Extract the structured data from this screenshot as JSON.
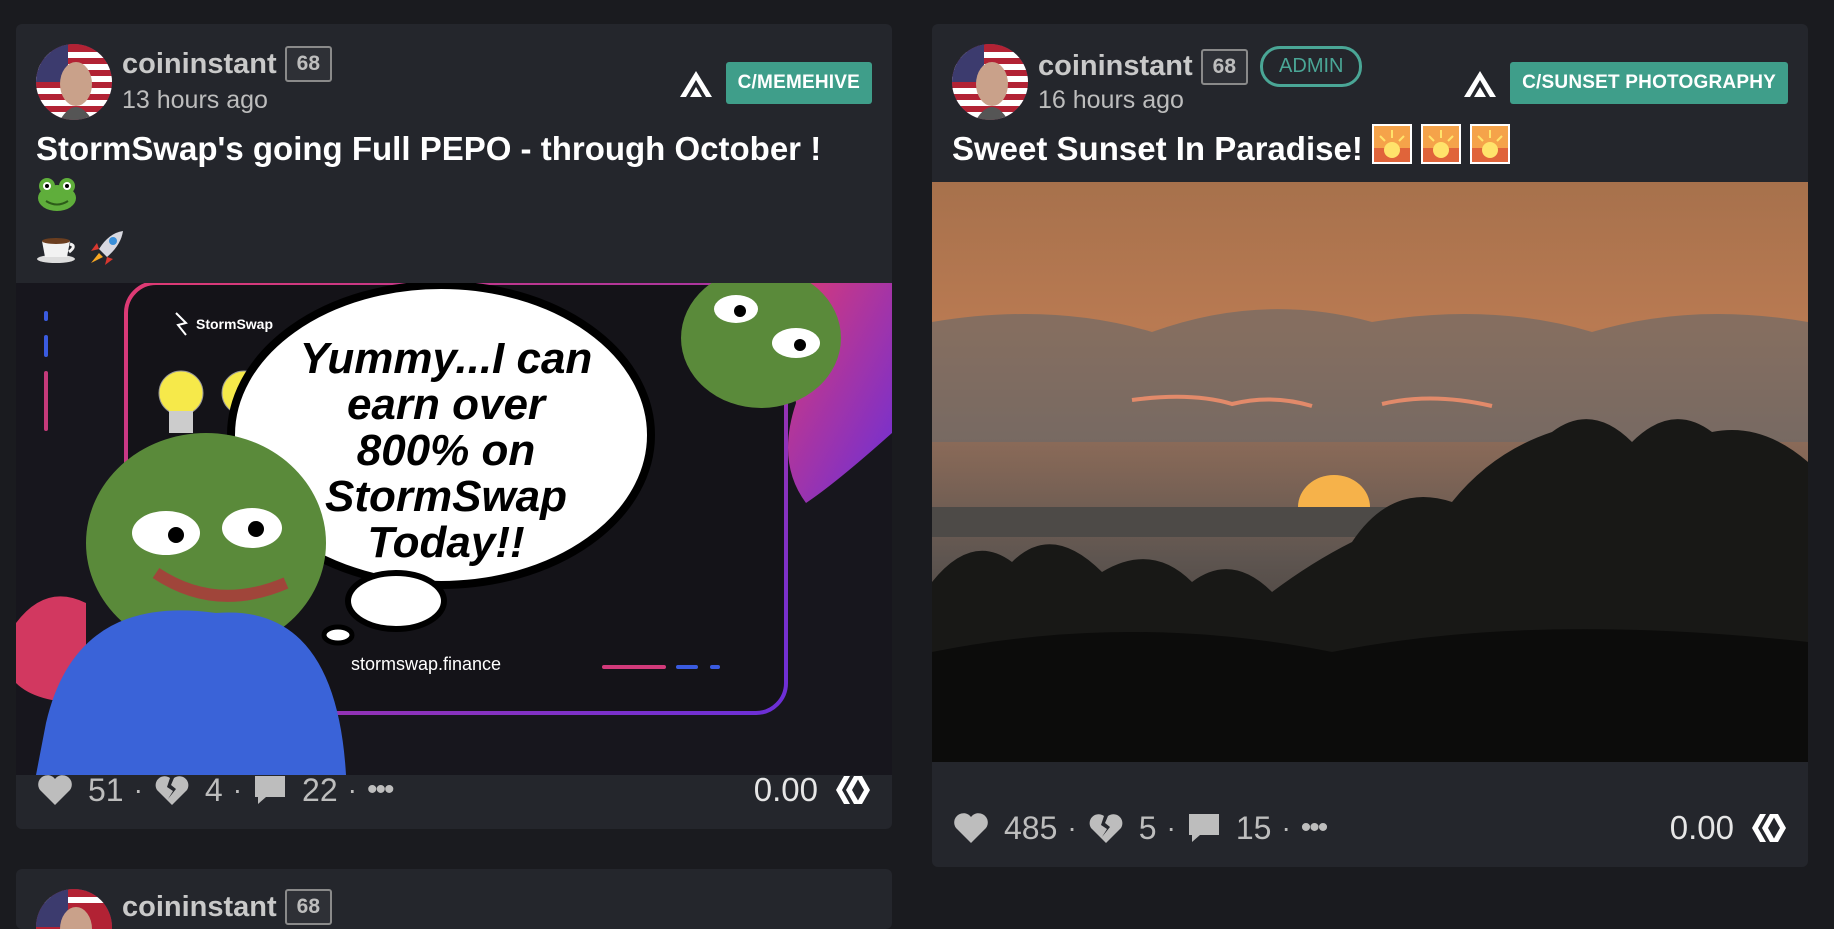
{
  "posts": [
    {
      "author": "coininstant",
      "reputation": "68",
      "time": "13 hours ago",
      "community": "C/MEMEHIVE",
      "title_line1": "StormSwap's going Full PEPO - through October !",
      "image": {
        "brand": "StormSwap",
        "speech": [
          "Yummy...I can",
          "earn over",
          "800% on",
          "StormSwap",
          "Today!!"
        ],
        "site": "stormswap.finance"
      },
      "upvotes": "51",
      "downvotes": "4",
      "comments": "22",
      "more": "•••",
      "payout": "0.00"
    },
    {
      "author": "coininstant",
      "reputation": "68",
      "badge": "ADMIN",
      "time": "16 hours ago",
      "community": "C/SUNSET PHOTOGRAPHY",
      "title": "Sweet Sunset In Paradise!",
      "upvotes": "485",
      "downvotes": "5",
      "comments": "15",
      "more": "•••",
      "payout": "0.00"
    },
    {
      "author": "coininstant",
      "reputation": "68"
    }
  ],
  "colors": {
    "background": "#1a1b1f",
    "card": "#24262c",
    "accent": "#3f9e8a"
  },
  "icons": [
    "heart-icon",
    "broken-heart-icon",
    "comment-icon",
    "hive-logo-icon"
  ]
}
